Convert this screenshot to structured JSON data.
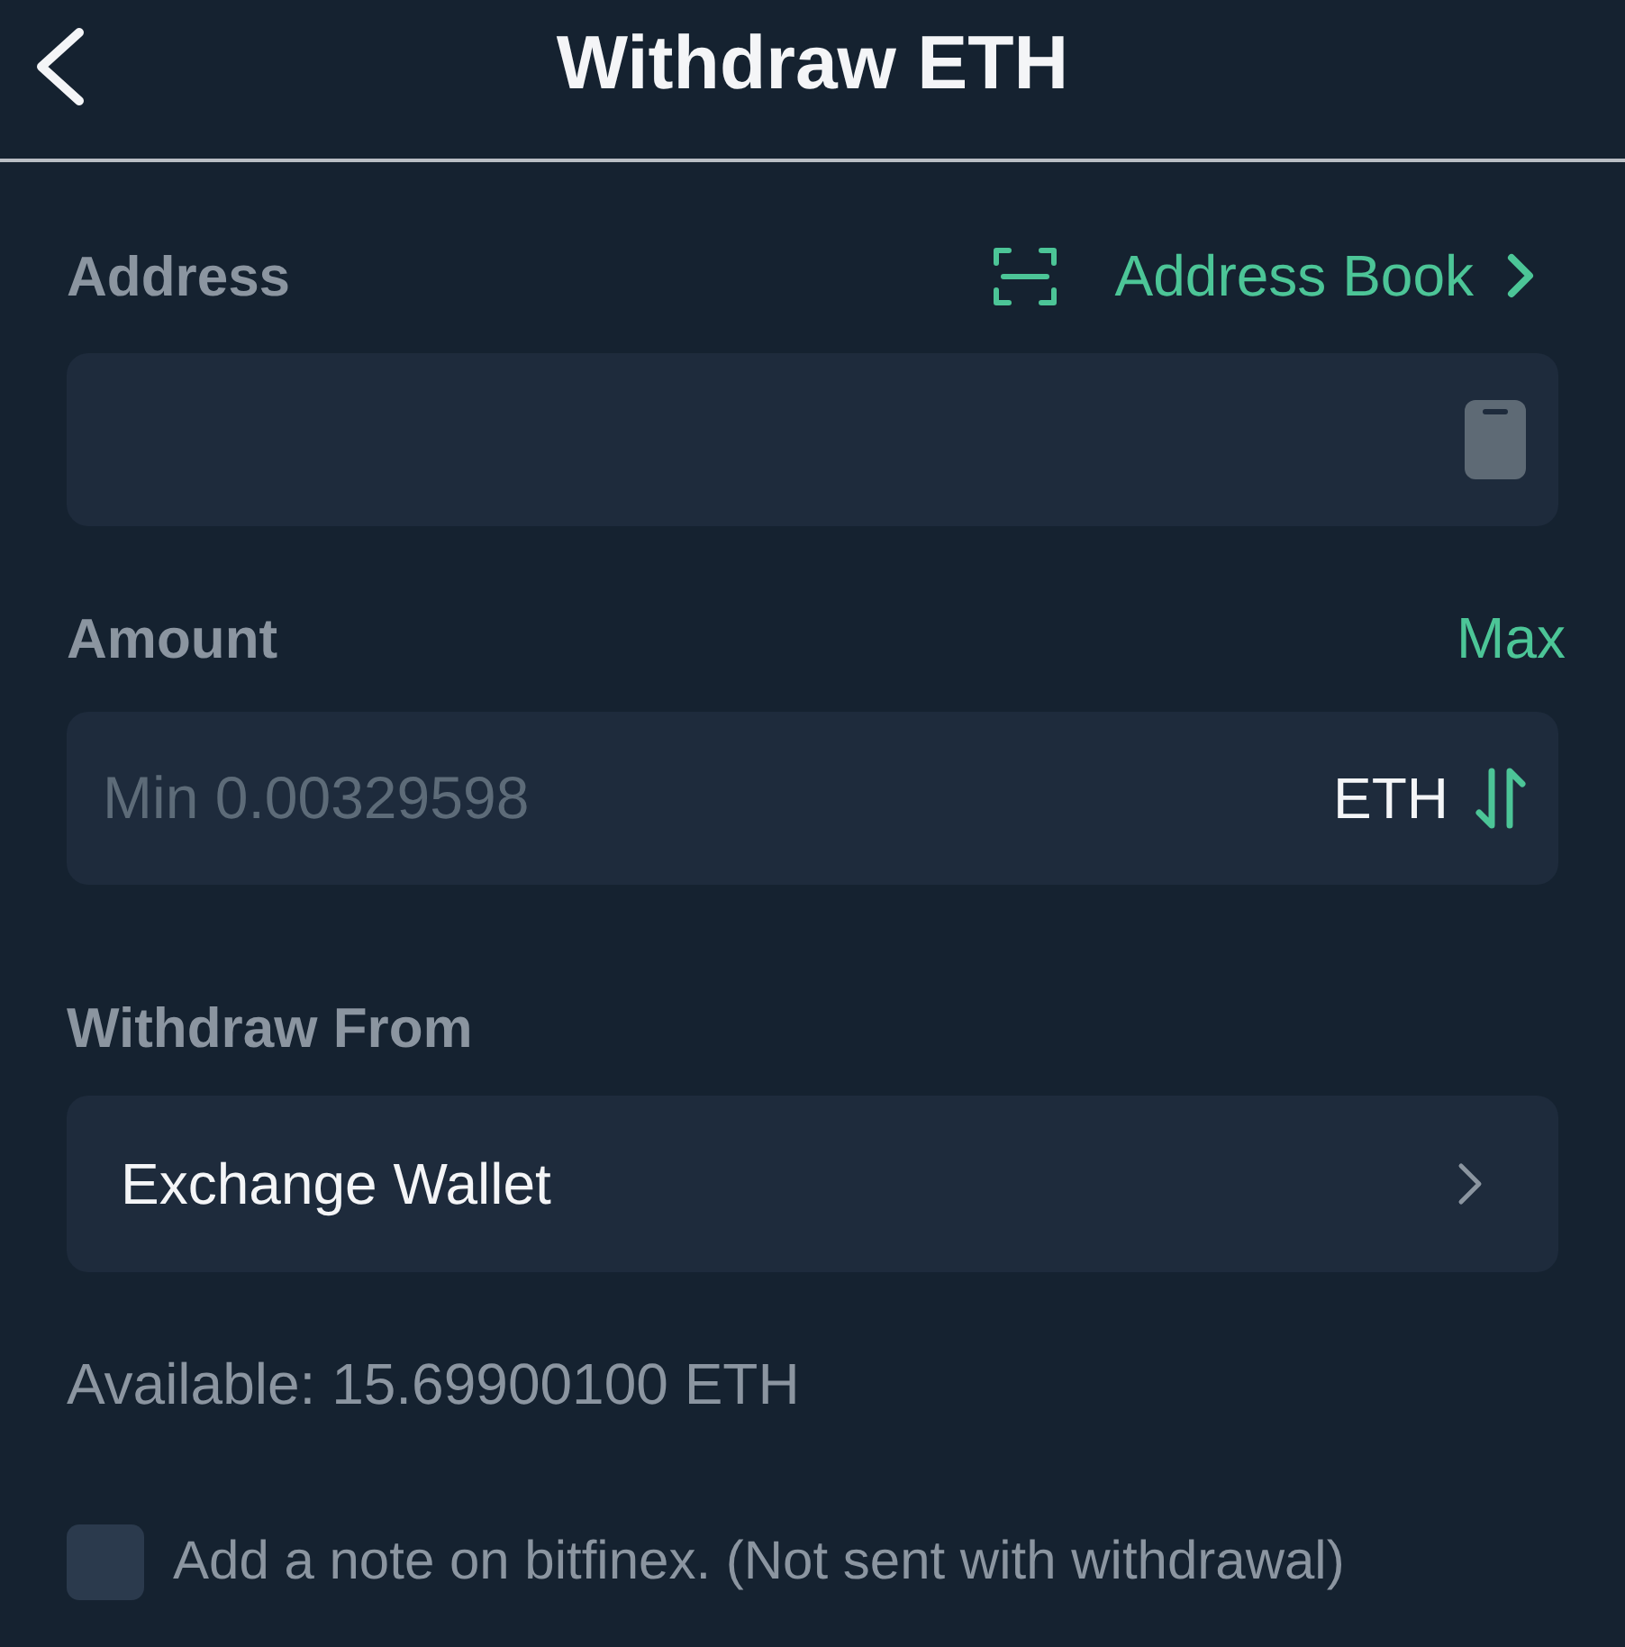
{
  "header": {
    "title": "Withdraw ETH"
  },
  "address": {
    "label": "Address",
    "address_book": "Address Book"
  },
  "amount": {
    "label": "Amount",
    "max": "Max",
    "placeholder": "Min 0.00329598",
    "unit": "ETH"
  },
  "withdraw_from": {
    "label": "Withdraw From",
    "value": "Exchange Wallet"
  },
  "available": "Available: 15.69900100 ETH",
  "note": {
    "label": "Add a note on bitfinex. (Not sent with withdrawal)",
    "checked": false
  }
}
